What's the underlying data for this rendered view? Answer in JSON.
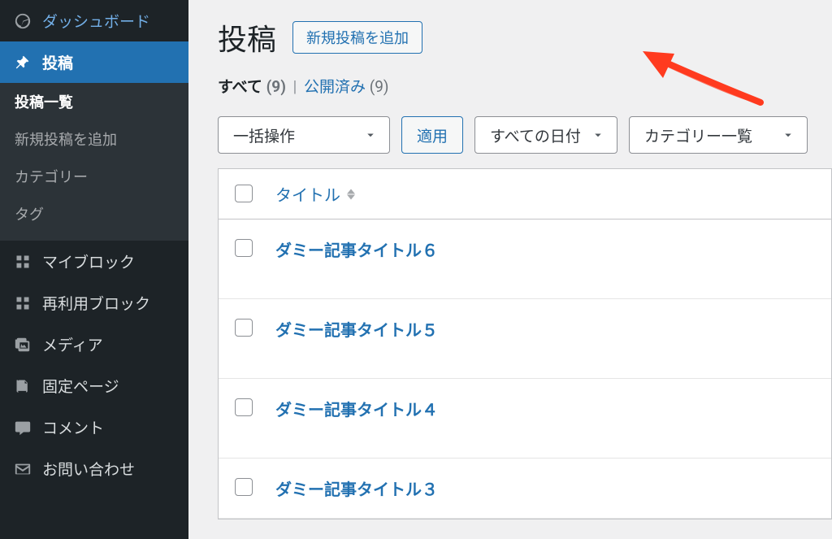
{
  "sidebar": {
    "dashboard": "ダッシュボード",
    "posts": "投稿",
    "submenu": {
      "all_posts": "投稿一覧",
      "add_new": "新規投稿を追加",
      "categories": "カテゴリー",
      "tags": "タグ"
    },
    "my_block": "マイブロック",
    "reusable_block": "再利用ブロック",
    "media": "メディア",
    "pages": "固定ページ",
    "comments": "コメント",
    "contact": "お問い合わせ"
  },
  "page": {
    "title": "投稿",
    "add_new": "新規投稿を追加"
  },
  "filters": {
    "all_label": "すべて",
    "all_count": "(9)",
    "sep": "|",
    "published_label": "公開済み",
    "published_count": "(9)"
  },
  "controls": {
    "bulk_action": "一括操作",
    "apply": "適用",
    "all_dates": "すべての日付",
    "category_list": "カテゴリー一覧"
  },
  "table": {
    "title_header": "タイトル"
  },
  "posts": [
    {
      "title": "ダミー記事タイトル６"
    },
    {
      "title": "ダミー記事タイトル５"
    },
    {
      "title": "ダミー記事タイトル４"
    },
    {
      "title": "ダミー記事タイトル３"
    }
  ]
}
